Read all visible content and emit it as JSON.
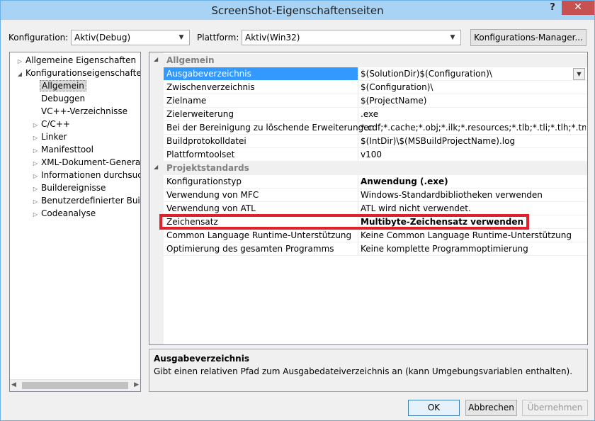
{
  "window": {
    "title": "ScreenShot-Eigenschaftenseiten",
    "help": "?",
    "close": "✕"
  },
  "config": {
    "konfiguration_label": "Konfiguration:",
    "konfiguration_value": "Aktiv(Debug)",
    "plattform_label": "Plattform:",
    "plattform_value": "Aktiv(Win32)",
    "manager_button": "Konfigurations-Manager..."
  },
  "tree": {
    "items": [
      {
        "label": "Allgemeine Eigenschaften",
        "expander": "▷"
      },
      {
        "label": "Konfigurationseigenschaften",
        "expander": "◢"
      },
      {
        "label": "Allgemein",
        "expander": ""
      },
      {
        "label": "Debuggen",
        "expander": ""
      },
      {
        "label": "VC++-Verzeichnisse",
        "expander": ""
      },
      {
        "label": "C/C++",
        "expander": "▷"
      },
      {
        "label": "Linker",
        "expander": "▷"
      },
      {
        "label": "Manifesttool",
        "expander": "▷"
      },
      {
        "label": "XML-Dokument-Generator",
        "expander": "▷"
      },
      {
        "label": "Informationen durchsuchen",
        "expander": "▷"
      },
      {
        "label": "Buildereignisse",
        "expander": "▷"
      },
      {
        "label": "Benutzerdefinierter Buildschritt",
        "expander": "▷"
      },
      {
        "label": "Codeanalyse",
        "expander": "▷"
      }
    ],
    "selected": "Allgemein"
  },
  "grid": {
    "categories": [
      {
        "title": "Allgemein",
        "rows": [
          {
            "name": "Ausgabeverzeichnis",
            "value": "$(SolutionDir)$(Configuration)\\"
          },
          {
            "name": "Zwischenverzeichnis",
            "value": "$(Configuration)\\"
          },
          {
            "name": "Zielname",
            "value": "$(ProjectName)"
          },
          {
            "name": "Zielerweiterung",
            "value": ".exe"
          },
          {
            "name": "Bei der Bereinigung zu löschende Erweiterungen",
            "value": "*.cdf;*.cache;*.obj;*.ilk;*.resources;*.tlb;*.tli;*.tlh;*.tmp;*.rsp;*.pgc;*.pgd;*.meta;$(TargetPath)"
          },
          {
            "name": "Buildprotokolldatei",
            "value": "$(IntDir)\\$(MSBuildProjectName).log"
          },
          {
            "name": "Plattformtoolset",
            "value": "v100"
          }
        ]
      },
      {
        "title": "Projektstandards",
        "rows": [
          {
            "name": "Konfigurationstyp",
            "value": "Anwendung (.exe)"
          },
          {
            "name": "Verwendung von MFC",
            "value": "Windows-Standardbibliotheken verwenden"
          },
          {
            "name": "Verwendung von ATL",
            "value": "ATL wird nicht verwendet."
          },
          {
            "name": "Zeichensatz",
            "value": "Multibyte-Zeichensatz verwenden"
          },
          {
            "name": "Common Language Runtime-Unterstützung",
            "value": "Keine Common Language Runtime-Unterstützung"
          },
          {
            "name": "Optimierung des gesamten Programms",
            "value": "Keine komplette Programmoptimierung"
          }
        ]
      }
    ],
    "selected_row": "Ausgabeverzeichnis",
    "highlighted_row": "Zeichensatz"
  },
  "description": {
    "title": "Ausgabeverzeichnis",
    "text": "Gibt einen relativen Pfad zum Ausgabedateiverzeichnis an (kann Umgebungsvariablen enthalten)."
  },
  "buttons": {
    "ok": "OK",
    "cancel": "Abbrechen",
    "apply": "Übernehmen"
  },
  "colors": {
    "titlebar": "#a9d3f4",
    "close": "#c75050",
    "selection": "#3399ff",
    "highlight_box": "#e0202a"
  }
}
